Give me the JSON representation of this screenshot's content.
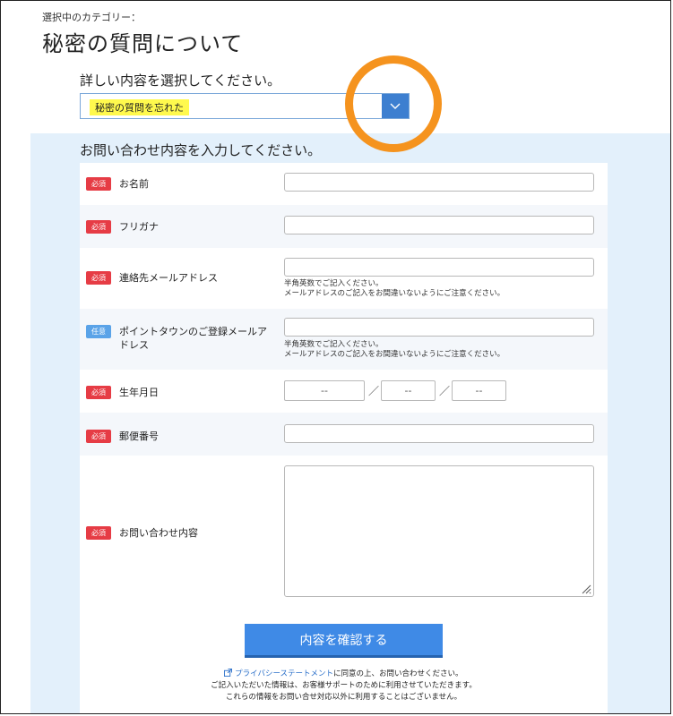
{
  "header": {
    "category_label": "選択中のカテゴリー：",
    "page_title": "秘密の質問について"
  },
  "detail": {
    "label": "詳しい内容を選択してください。",
    "selected": "秘密の質問を忘れた"
  },
  "form": {
    "title": "お問い合わせ内容を入力してください。",
    "badges": {
      "required": "必須",
      "optional": "任意"
    },
    "fields": {
      "name": "お名前",
      "furigana": "フリガナ",
      "email": "連絡先メールアドレス",
      "point_email": "ポイントタウンのご登録メールアドレス",
      "birthday": "生年月日",
      "postal": "郵便番号",
      "inquiry": "お問い合わせ内容"
    },
    "email_note_1": "半角英数でご記入ください。",
    "email_note_2": "メールアドレスのご記入をお間違いないようにご注意ください。",
    "date_placeholder": "--",
    "date_separator": "／",
    "submit_label": "内容を確認する",
    "footnote": {
      "link": "プライバシーステートメント",
      "line1_suffix": "に同意の上、お問い合わせください。",
      "line2": "ご記入いただいた情報は、お客様サポートのために利用させていただきます。",
      "line3": "これらの情報をお問い合せ対応以外に利用することはございません。"
    }
  },
  "colors": {
    "accent": "#3d7fd0",
    "required": "#e63c45",
    "optional": "#5aa3e8",
    "highlight": "#fff94d",
    "annotation": "#f5931e",
    "panel": "#e3f0fb"
  }
}
